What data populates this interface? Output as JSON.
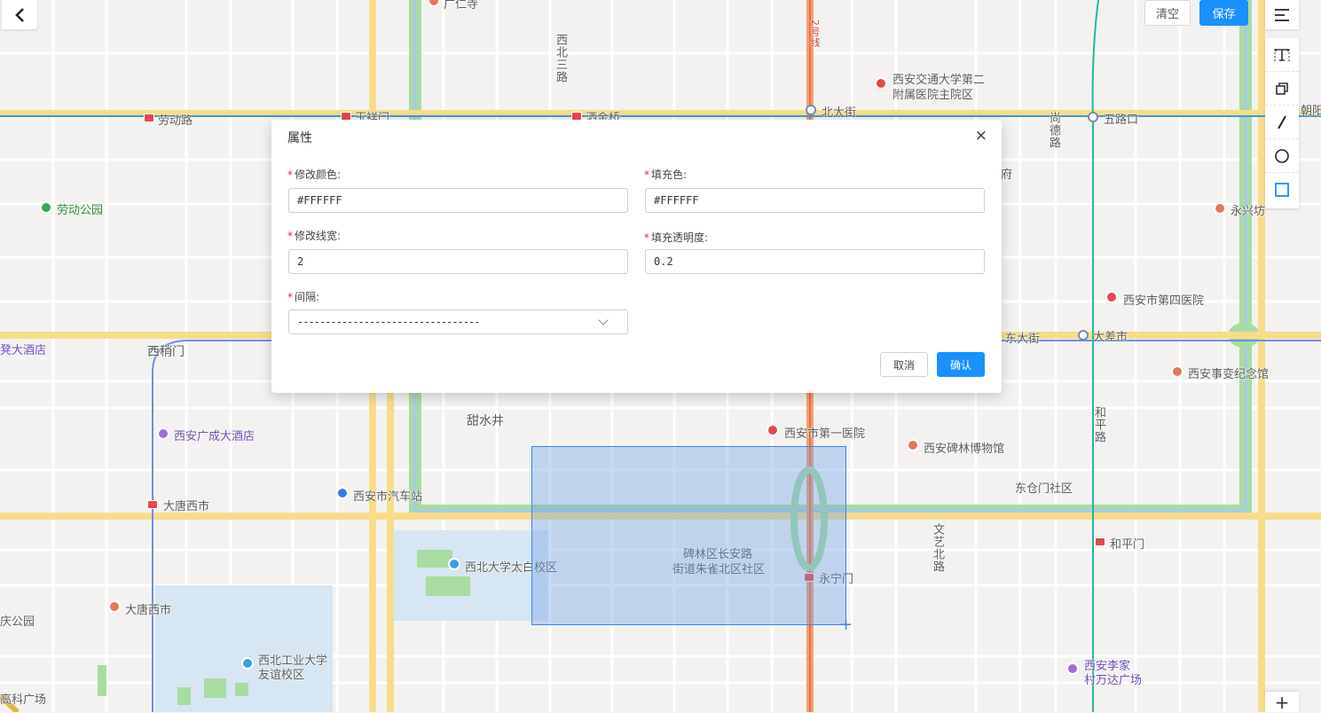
{
  "toolbar": {
    "back_icon": "chevron-left-icon",
    "clear_label": "清空",
    "save_label": "保存",
    "menu_icon": "menu-icon",
    "tools": [
      "text-tool-icon",
      "copy-tool-icon",
      "line-tool-icon",
      "circle-tool-icon",
      "rectangle-tool-icon"
    ],
    "zoom_in_label": "+"
  },
  "modal": {
    "title": "属性",
    "close_label": "×",
    "fields": {
      "stroke_color": {
        "label": "修改颜色:",
        "value": "#FFFFFF"
      },
      "fill_color": {
        "label": "填充色:",
        "value": "#FFFFFF"
      },
      "stroke_width": {
        "label": "修改线宽:",
        "value": "2"
      },
      "fill_opacity": {
        "label": "填充透明度:",
        "value": "0.2"
      },
      "dash": {
        "label": "间隔:",
        "value": "---------------------------------"
      }
    },
    "required_mark": "*",
    "cancel_label": "取消",
    "confirm_label": "确认"
  },
  "map": {
    "labels": {
      "laodong_road": "劳动路",
      "yuxiangmen": "玉祥门",
      "sajinqiao": "洒金桥",
      "xibeisanlu": "西北三路",
      "beidajie": "北大街",
      "jiaoda_hospital_1": "西安交通大学第二",
      "jiaoda_hospital_2": "附属医院主院区",
      "line2": "2号线",
      "shangde_road": "尚德路",
      "wulukou": "五路口",
      "chaoyang": "朝阳",
      "yongxingfang": "永兴坊",
      "laodong_park": "劳动公园",
      "fourth_hospital": "西安市第四医院",
      "dachashi": "大差市",
      "dongdajie": "东大街",
      "xishaomen": "西稍门",
      "hotel_left": "凳大酒店",
      "xian_incident_museum": "西安事变纪念馆",
      "tianshuijing": "甜水井",
      "first_hospital": "西安市第一医院",
      "beilin_museum": "西安碑林博物馆",
      "guangcheng_hotel": "西安广成大酒店",
      "heping_road": "和平路",
      "datang_xishi_station": "大唐西市",
      "bus_station": "西安市汽车站",
      "dongcangmen": "东仓门社区",
      "wenyi_north_road": "文艺北路",
      "hepingmen": "和平门",
      "xibei_univ": "西北大学太白校区",
      "changan_road_1": "碑林区长安路",
      "changan_road_2": "街道朱雀北区社区",
      "yongningmen": "永宁门",
      "datang_xishi_poi": "大唐西市",
      "park_left": "庆公园",
      "nwpu_1": "西北工业大学",
      "nwpu_2": "友谊校区",
      "lijia_wanda_1": "西安李家",
      "lijia_wanda_2": "村万达广场",
      "keji_square": "高科广场",
      "guangren_temple": "广仁寺",
      "ju": "府"
    }
  }
}
